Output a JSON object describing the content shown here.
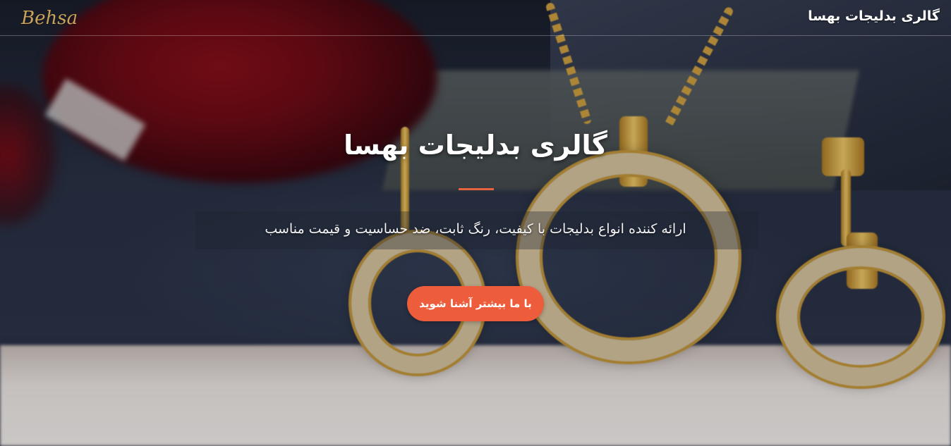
{
  "navbar": {
    "brand_title": "گالری بدلیجات بهسا",
    "logo_text": "Behsa"
  },
  "hero": {
    "title": "گالری بدلیجات بهسا",
    "subtitle": "ارائه کننده انواع بدلیجات با کیفیت، رنگ ثابت، ضد حساسیت و قیمت مناسب",
    "cta_label": "با ما بیشتر آشنا شوید"
  },
  "colors": {
    "accent": "#ee5d3b",
    "divider": "#e8623f",
    "logo_gold": "#c9a35a"
  }
}
